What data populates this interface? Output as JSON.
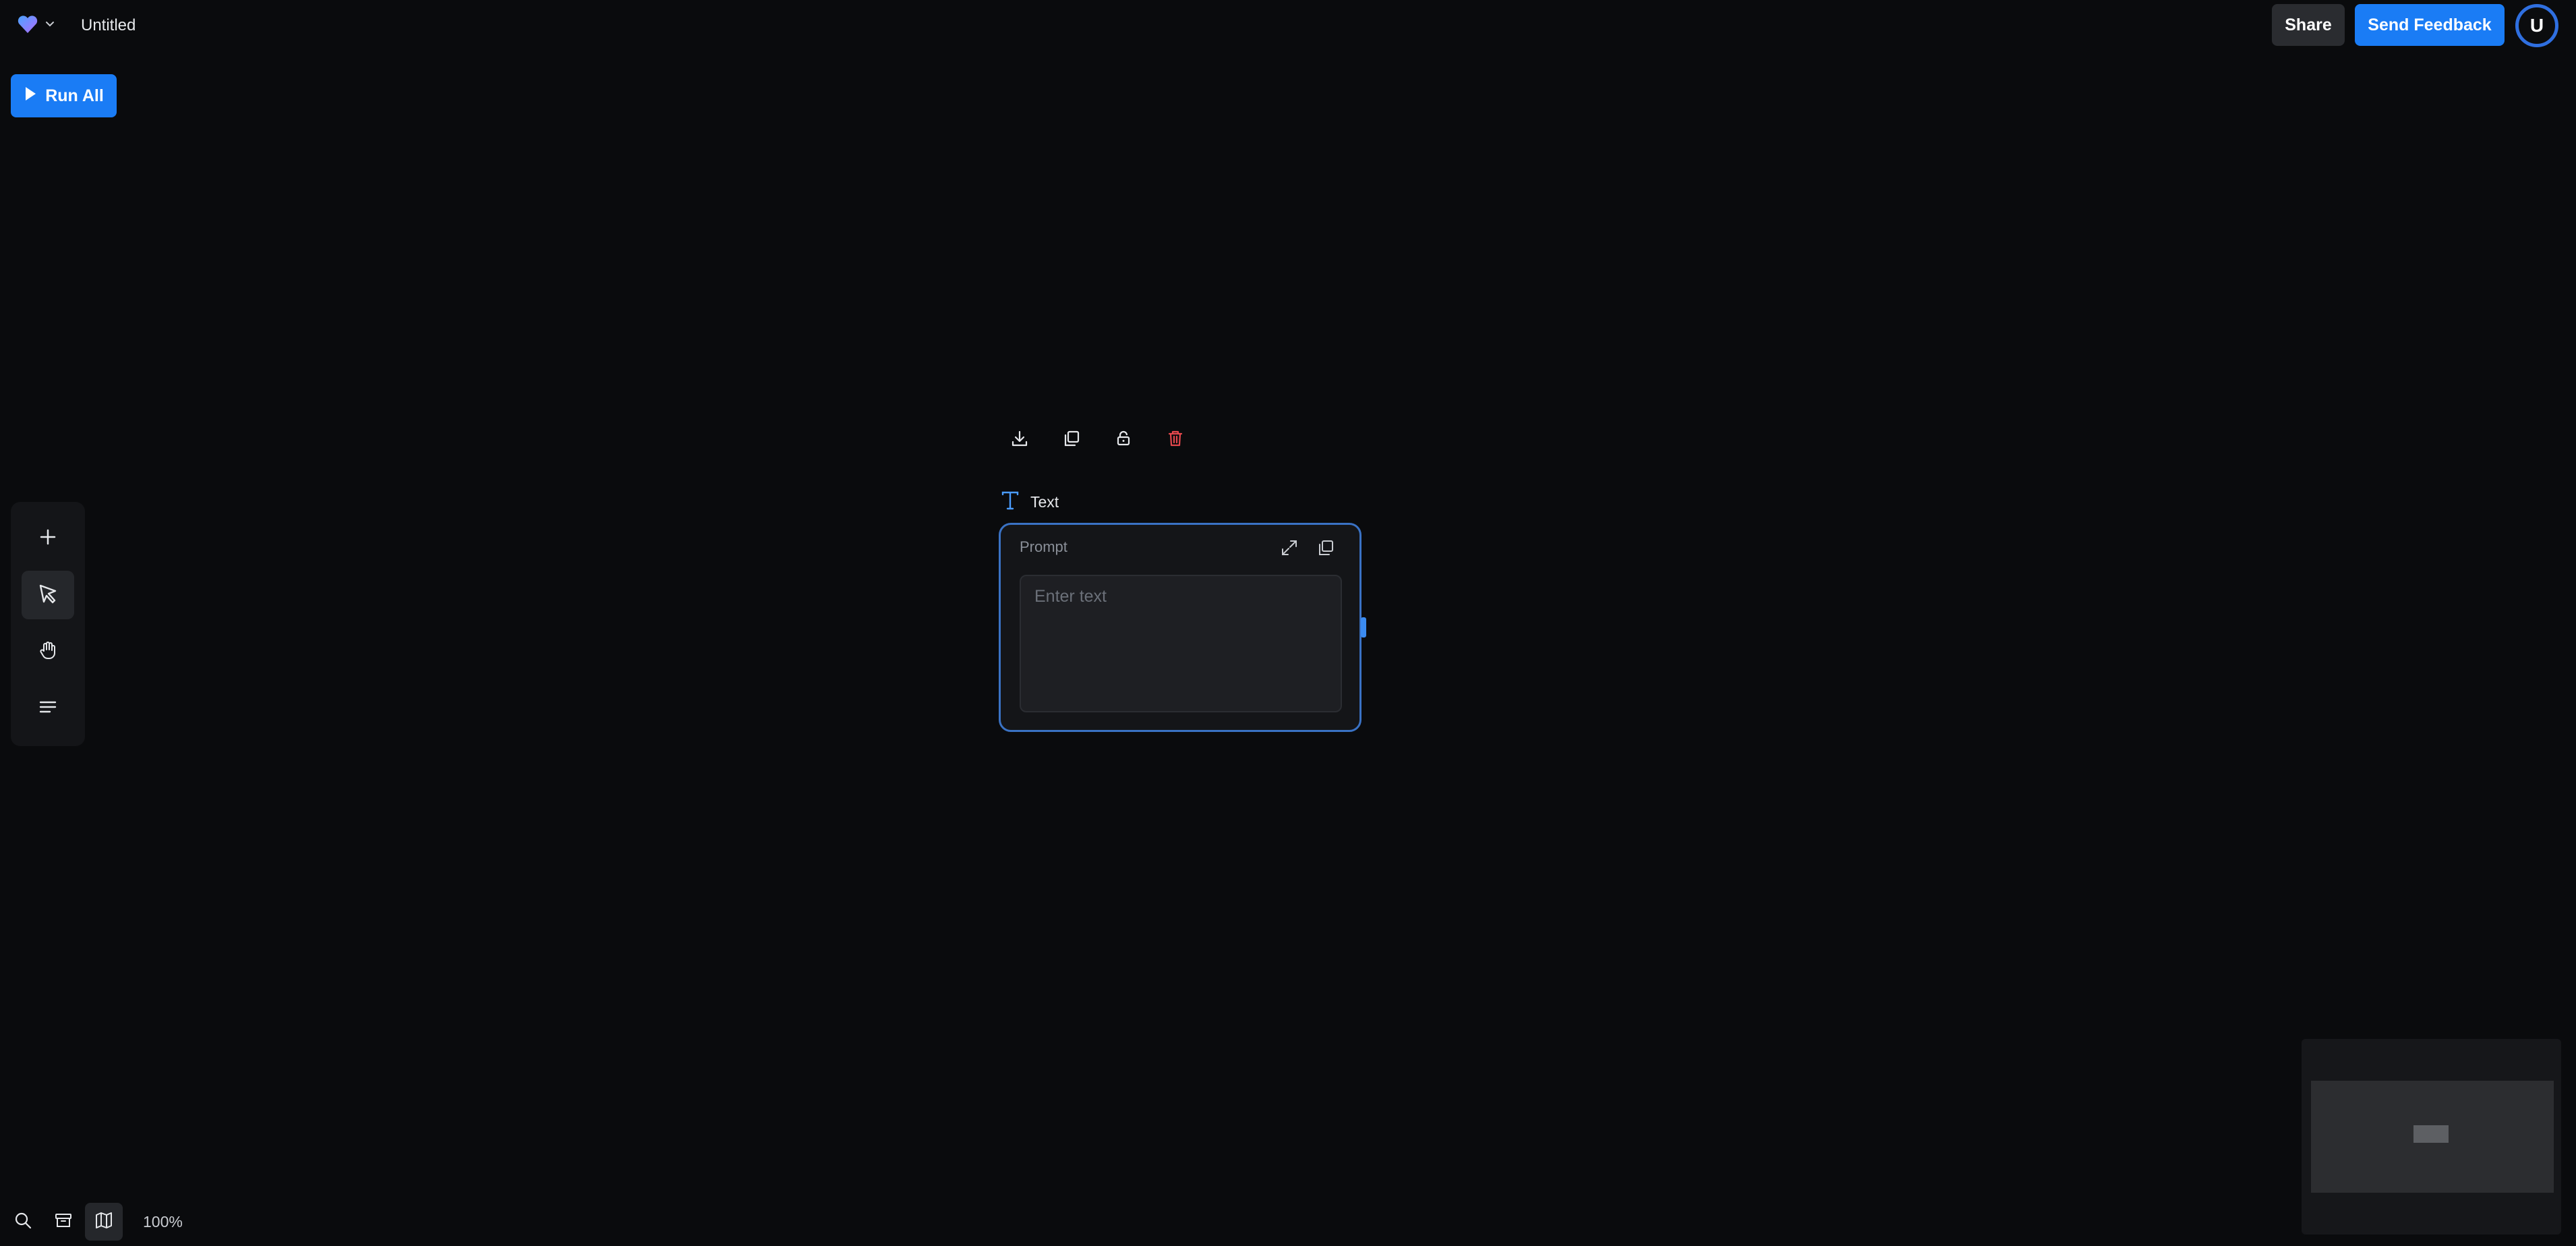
{
  "app": {
    "title": "Untitled",
    "logo_icon": "heart-logo-icon"
  },
  "header": {
    "share_label": "Share",
    "feedback_label": "Send Feedback",
    "avatar_initial": "U",
    "colors": {
      "primary": "#1a7cf5",
      "secondary_button": "#2a2c30"
    }
  },
  "toolbar": {
    "run_all_label": "Run All"
  },
  "left_tools": [
    {
      "icon": "plus-icon",
      "active": false
    },
    {
      "icon": "cursor-icon",
      "active": true
    },
    {
      "icon": "hand-icon",
      "active": false
    },
    {
      "icon": "list-icon",
      "active": false
    }
  ],
  "node_toolbar": [
    {
      "icon": "download-icon"
    },
    {
      "icon": "duplicate-icon"
    },
    {
      "icon": "unlock-icon"
    },
    {
      "icon": "trash-icon",
      "color": "#e5484d"
    }
  ],
  "node": {
    "type_label": "Text",
    "field_label": "Prompt",
    "placeholder": "Enter text",
    "border_color": "#3a72c4"
  },
  "bottom_bar": {
    "zoom": "100%"
  }
}
